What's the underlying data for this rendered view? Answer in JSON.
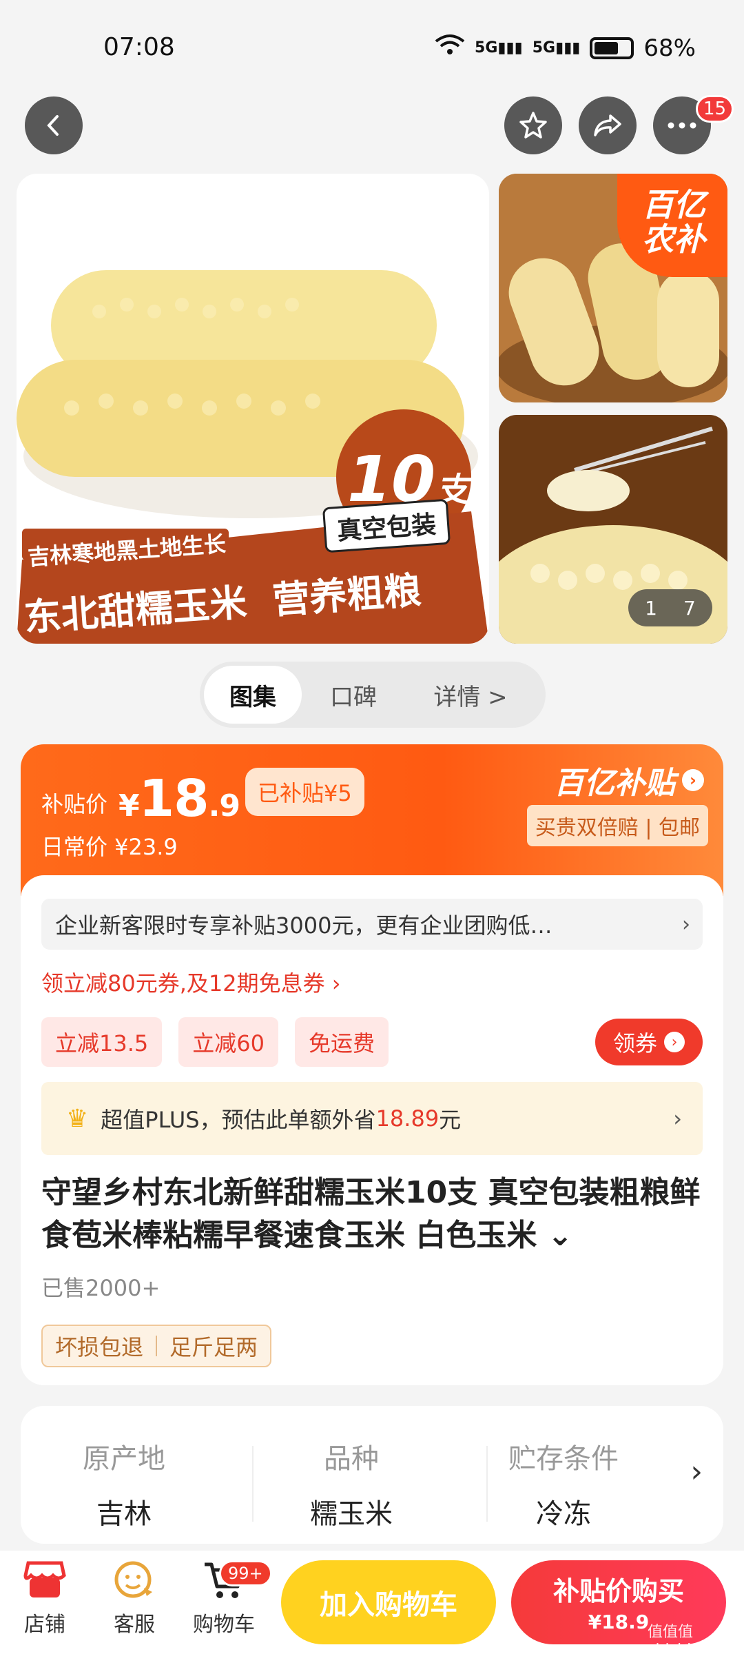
{
  "status": {
    "time": "07:08",
    "battery": "68%",
    "signal1": "5G",
    "signal2": "5G"
  },
  "nav": {
    "more_badge": "15"
  },
  "gallery": {
    "main_count": "10",
    "main_unit": "支",
    "main_pack": "真空包装",
    "main_tagline": "吉林寒地黑土地生长",
    "main_slogan": "东北甜糯玉米  营养粗粮",
    "thumb_logo": "百亿\n农补",
    "pager_current": "1",
    "pager_total": "7"
  },
  "tabs": [
    {
      "label": "图集"
    },
    {
      "label": "口碑"
    },
    {
      "label": "详情 >"
    }
  ],
  "price": {
    "subsidy_label": "补贴价",
    "currency": "¥",
    "int": "18",
    "dec": ".9",
    "subsidy_tag": "已补贴¥5",
    "daily": "日常价 ¥23.9",
    "brand": "百亿补贴",
    "brand_sub": "买贵双倍赔 | 包邮",
    "notice": "企业新客限时专享补贴3000元，更有企业团购低…",
    "coupon_line": "领立减80元券,及12期免息券 ›",
    "chips": [
      "立减13.5",
      "立减60",
      "免运费"
    ],
    "coupon_btn": "领券",
    "plus_text": "超值PLUS，预估此单额外省",
    "plus_save": "18.89",
    "plus_unit": "元",
    "title": "守望乡村东北新鲜甜糯玉米10支 真空包装粗粮鲜食苞米棒粘糯早餐速食玉米 白色玉米 ⌄",
    "sold": "已售2000+",
    "guarantees": [
      "坏损包退",
      "足斤足两"
    ]
  },
  "specs": [
    {
      "key": "原产地",
      "value": "吉林"
    },
    {
      "key": "品种",
      "value": "糯玉米"
    },
    {
      "key": "贮存条件",
      "value": "冷冻"
    }
  ],
  "bottom": {
    "shop": "店铺",
    "service": "客服",
    "cart": "购物车",
    "cart_badge": "99+",
    "add_cart": "加入购物车",
    "buy_l1": "补贴价购买",
    "buy_l2": "¥18.9",
    "watermark": "值值值 zhizhizhi.com"
  }
}
